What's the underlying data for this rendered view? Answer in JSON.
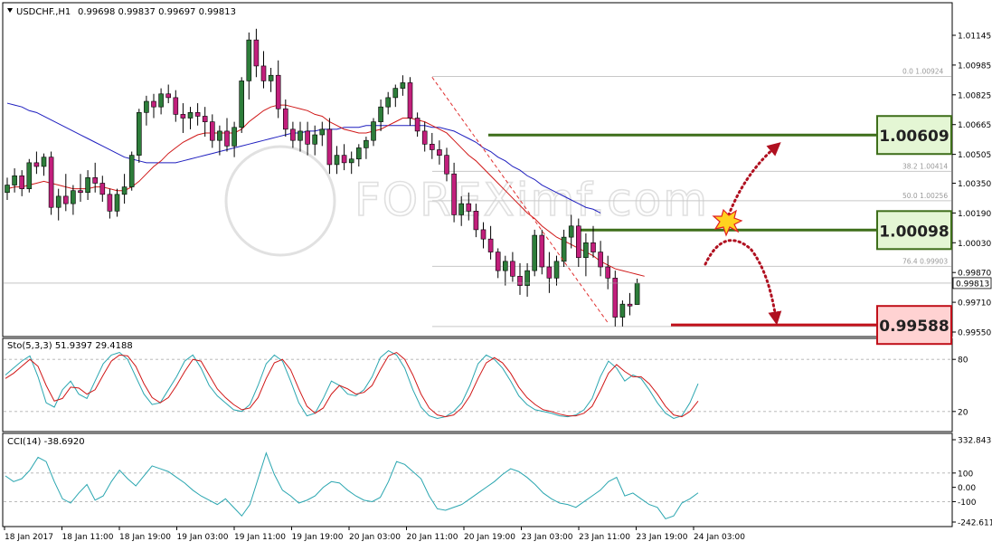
{
  "header": {
    "symbol": "USDCHF.,H1",
    "ohlc": "0.99698 0.99837 0.99697 0.99813"
  },
  "watermark": "FOREXimf.com",
  "chart_data": [
    {
      "type": "candlestick",
      "symbol": "USDCHF.,H1",
      "ylim": [
        0.9955,
        1.01145
      ],
      "price_ticks": [
        "1.01145",
        "1.00985",
        "1.00825",
        "1.00665",
        "1.00505",
        "1.00350",
        "1.00190",
        "1.00030",
        "0.99870",
        "0.99710",
        "0.99550"
      ],
      "current_price": "0.99813",
      "time_labels": [
        "18 Jan 2017",
        "18 Jan 11:00",
        "18 Jan 19:00",
        "19 Jan 03:00",
        "19 Jan 11:00",
        "19 Jan 19:00",
        "20 Jan 03:00",
        "20 Jan 11:00",
        "20 Jan 19:00",
        "23 Jan 03:00",
        "23 Jan 11:00",
        "23 Jan 19:00",
        "24 Jan 03:00"
      ],
      "fib_levels": [
        {
          "label": "0.0  1.00924",
          "value": 1.00924
        },
        {
          "label": "38.2  1.00414",
          "value": 1.00414
        },
        {
          "label": "50.0  1.00256",
          "value": 1.00256
        },
        {
          "label": "76.4  0.99903",
          "value": 0.99903
        }
      ],
      "key_levels": [
        {
          "label": "1.00609",
          "value": 1.00609,
          "color": "#3e6e1a",
          "fill": "#e4f6d4"
        },
        {
          "label": "1.00098",
          "value": 1.00098,
          "color": "#3e6e1a",
          "fill": "#e4f6d4"
        },
        {
          "label": "0.99588",
          "value": 0.99588,
          "color": "#c0101a",
          "fill": "#ffd2d2"
        }
      ],
      "bull_color": "#2d7d3a",
      "bear_color": "#c21f7c",
      "candles": [
        [
          1.003,
          1.0038,
          1.0026,
          1.0034
        ],
        [
          1.0034,
          1.0043,
          1.003,
          1.0039
        ],
        [
          1.0039,
          1.0042,
          1.0028,
          1.0032
        ],
        [
          1.0032,
          1.0048,
          1.003,
          1.0046
        ],
        [
          1.0046,
          1.0052,
          1.004,
          1.0044
        ],
        [
          1.0044,
          1.0051,
          1.0039,
          1.0049
        ],
        [
          1.0049,
          1.0052,
          1.0018,
          1.0022
        ],
        [
          1.0022,
          1.0032,
          1.0015,
          1.0028
        ],
        [
          1.0028,
          1.004,
          1.002,
          1.0024
        ],
        [
          1.0024,
          1.0034,
          1.0018,
          1.0031
        ],
        [
          1.0031,
          1.004,
          1.0025,
          1.003
        ],
        [
          1.003,
          1.0042,
          1.0026,
          1.0038
        ],
        [
          1.0038,
          1.0046,
          1.003,
          1.0035
        ],
        [
          1.0035,
          1.0039,
          1.0025,
          1.0029
        ],
        [
          1.0029,
          1.0032,
          1.0016,
          1.002
        ],
        [
          1.002,
          1.0032,
          1.0017,
          1.0029
        ],
        [
          1.0029,
          1.004,
          1.0024,
          1.0033
        ],
        [
          1.0033,
          1.0052,
          1.0031,
          1.005
        ],
        [
          1.005,
          1.0075,
          1.0046,
          1.0073
        ],
        [
          1.0073,
          1.0082,
          1.0066,
          1.0079
        ],
        [
          1.0079,
          1.0083,
          1.007,
          1.0076
        ],
        [
          1.0076,
          1.0086,
          1.0072,
          1.0083
        ],
        [
          1.0083,
          1.0088,
          1.0078,
          1.0081
        ],
        [
          1.0081,
          1.0085,
          1.0068,
          1.0072
        ],
        [
          1.0072,
          1.0078,
          1.0062,
          1.007
        ],
        [
          1.007,
          1.0076,
          1.0064,
          1.0073
        ],
        [
          1.0073,
          1.0078,
          1.0066,
          1.0071
        ],
        [
          1.0071,
          1.0076,
          1.006,
          1.0068
        ],
        [
          1.0068,
          1.0072,
          1.0054,
          1.0058
        ],
        [
          1.0058,
          1.0066,
          1.005,
          1.0063
        ],
        [
          1.0063,
          1.007,
          1.0052,
          1.0055
        ],
        [
          1.0055,
          1.0068,
          1.0049,
          1.0065
        ],
        [
          1.0065,
          1.0092,
          1.0062,
          1.009
        ],
        [
          1.009,
          1.0116,
          1.008,
          1.0112
        ],
        [
          1.0112,
          1.0118,
          1.0092,
          1.0098
        ],
        [
          1.0098,
          1.0106,
          1.0086,
          1.009
        ],
        [
          1.009,
          1.0097,
          1.0084,
          1.0093
        ],
        [
          1.0093,
          1.0101,
          1.007,
          1.0075
        ],
        [
          1.0075,
          1.008,
          1.006,
          1.0064
        ],
        [
          1.0064,
          1.0068,
          1.0054,
          1.0058
        ],
        [
          1.0058,
          1.0068,
          1.0052,
          1.0063
        ],
        [
          1.0063,
          1.0068,
          1.005,
          1.0056
        ],
        [
          1.0056,
          1.0066,
          1.005,
          1.0061
        ],
        [
          1.0061,
          1.0068,
          1.0055,
          1.0064
        ],
        [
          1.0064,
          1.007,
          1.004,
          1.0045
        ],
        [
          1.0045,
          1.0055,
          1.004,
          1.005
        ],
        [
          1.005,
          1.0056,
          1.0042,
          1.0046
        ],
        [
          1.0046,
          1.0052,
          1.004,
          1.0048
        ],
        [
          1.0048,
          1.0056,
          1.0044,
          1.0054
        ],
        [
          1.0054,
          1.006,
          1.0048,
          1.0058
        ],
        [
          1.0058,
          1.007,
          1.0055,
          1.0068
        ],
        [
          1.0068,
          1.008,
          1.0063,
          1.0076
        ],
        [
          1.0076,
          1.0084,
          1.0072,
          1.0081
        ],
        [
          1.0081,
          1.0088,
          1.0076,
          1.0086
        ],
        [
          1.0086,
          1.0093,
          1.0082,
          1.0089
        ],
        [
          1.0089,
          1.0092,
          1.0066,
          1.007
        ],
        [
          1.007,
          1.0073,
          1.006,
          1.0063
        ],
        [
          1.0063,
          1.0068,
          1.0052,
          1.0056
        ],
        [
          1.0056,
          1.0062,
          1.0048,
          1.0053
        ],
        [
          1.0053,
          1.0058,
          1.0045,
          1.005
        ],
        [
          1.005,
          1.0054,
          1.0036,
          1.004
        ],
        [
          1.004,
          1.0046,
          1.0014,
          1.0018
        ],
        [
          1.0018,
          1.0028,
          1.0012,
          1.0024
        ],
        [
          1.0024,
          1.003,
          1.0015,
          1.002
        ],
        [
          1.002,
          1.0024,
          1.0006,
          1.001
        ],
        [
          1.001,
          1.0014,
          1.0,
          1.0005
        ],
        [
          1.0005,
          1.0012,
          0.9994,
          0.9998
        ],
        [
          0.9998,
          1.0,
          0.9984,
          0.9988
        ],
        [
          0.9988,
          0.9996,
          0.998,
          0.9993
        ],
        [
          0.9993,
          0.9998,
          0.9982,
          0.9985
        ],
        [
          0.9985,
          0.9992,
          0.9975,
          0.998
        ],
        [
          0.998,
          0.9992,
          0.9974,
          0.9988
        ],
        [
          0.9988,
          1.001,
          0.9985,
          1.0007
        ],
        [
          1.0007,
          1.001,
          0.9986,
          0.999
        ],
        [
          0.999,
          0.9998,
          0.9976,
          0.9984
        ],
        [
          0.9984,
          0.9996,
          0.998,
          0.9993
        ],
        [
          0.9993,
          1.001,
          0.999,
          1.0006
        ],
        [
          1.0006,
          1.0018,
          1.0,
          1.0012
        ],
        [
          1.0012,
          1.0016,
          0.999,
          0.9995
        ],
        [
          0.9995,
          1.0008,
          0.9985,
          1.0003
        ],
        [
          1.0003,
          1.0012,
          0.9995,
          0.9998
        ],
        [
          0.9998,
          1.0004,
          0.9985,
          0.999
        ],
        [
          0.999,
          0.9996,
          0.9978,
          0.9984
        ],
        [
          0.9984,
          0.9988,
          0.9958,
          0.9963
        ],
        [
          0.9963,
          0.9972,
          0.9958,
          0.997
        ],
        [
          0.997,
          0.9976,
          0.9964,
          0.9969
        ],
        [
          0.99698,
          0.99837,
          0.99697,
          0.99813
        ]
      ],
      "ma_red": [
        1.0032,
        1.0033,
        1.0033,
        1.0034,
        1.0035,
        1.0036,
        1.0035,
        1.0034,
        1.0033,
        1.0032,
        1.0032,
        1.0032,
        1.0033,
        1.0033,
        1.0032,
        1.0031,
        1.0031,
        1.0033,
        1.0036,
        1.004,
        1.0044,
        1.0047,
        1.0051,
        1.0054,
        1.0057,
        1.0059,
        1.0061,
        1.0062,
        1.0062,
        1.0062,
        1.0062,
        1.0062,
        1.0064,
        1.0068,
        1.0071,
        1.0074,
        1.0076,
        1.0077,
        1.0077,
        1.0076,
        1.0075,
        1.0074,
        1.0072,
        1.0071,
        1.0068,
        1.0066,
        1.0064,
        1.0063,
        1.0062,
        1.0062,
        1.0063,
        1.0064,
        1.0066,
        1.0068,
        1.007,
        1.007,
        1.0069,
        1.0068,
        1.0066,
        1.0064,
        1.0062,
        1.0058,
        1.0054,
        1.005,
        1.0047,
        1.0043,
        1.0039,
        1.0035,
        1.0031,
        1.0027,
        1.0023,
        1.0019,
        1.0016,
        1.0012,
        1.0009,
        1.0006,
        1.0004,
        1.0002,
        1.0,
        0.9998,
        0.9996,
        0.9993,
        0.9991,
        0.9989,
        0.9988,
        0.9987,
        0.9986,
        0.9985
      ],
      "ma_blue": [
        1.0078,
        1.0077,
        1.0076,
        1.0074,
        1.0073,
        1.0071,
        1.0069,
        1.0067,
        1.0065,
        1.0063,
        1.0061,
        1.0059,
        1.0057,
        1.0055,
        1.0053,
        1.0051,
        1.0049,
        1.0048,
        1.0047,
        1.0046,
        1.0046,
        1.0046,
        1.0046,
        1.0046,
        1.0047,
        1.0048,
        1.0049,
        1.005,
        1.0051,
        1.0052,
        1.0053,
        1.0054,
        1.0055,
        1.0056,
        1.0057,
        1.0058,
        1.0059,
        1.006,
        1.0061,
        1.0062,
        1.0062,
        1.0063,
        1.0063,
        1.0064,
        1.0064,
        1.0064,
        1.0065,
        1.0065,
        1.0065,
        1.0066,
        1.0066,
        1.0066,
        1.0066,
        1.0066,
        1.0066,
        1.0066,
        1.0066,
        1.0066,
        1.0065,
        1.0065,
        1.0064,
        1.0063,
        1.0061,
        1.0059,
        1.0057,
        1.0054,
        1.0052,
        1.0049,
        1.0047,
        1.0044,
        1.0042,
        1.0039,
        1.0037,
        1.0034,
        1.0032,
        1.003,
        1.0028,
        1.0026,
        1.0024,
        1.0022,
        1.0021,
        1.0019
      ]
    },
    {
      "type": "line",
      "title": "Sto(5,3,3) 51.9397 29.4188",
      "ylim": [
        0,
        100
      ],
      "ticks": [
        "80",
        "20"
      ],
      "series": [
        {
          "name": "main",
          "color": "#2aa6b0",
          "values": [
            62,
            70,
            78,
            84,
            60,
            30,
            25,
            45,
            55,
            40,
            35,
            55,
            75,
            85,
            88,
            80,
            60,
            40,
            28,
            30,
            45,
            60,
            78,
            85,
            70,
            50,
            38,
            30,
            22,
            20,
            28,
            50,
            75,
            85,
            78,
            55,
            30,
            15,
            18,
            35,
            55,
            50,
            40,
            38,
            45,
            60,
            82,
            90,
            85,
            70,
            45,
            25,
            15,
            12,
            14,
            20,
            30,
            50,
            75,
            85,
            80,
            70,
            55,
            38,
            28,
            22,
            20,
            18,
            15,
            14,
            16,
            22,
            35,
            60,
            78,
            70,
            55,
            62,
            58,
            45,
            30,
            18,
            12,
            15,
            30,
            52
          ]
        },
        {
          "name": "signal",
          "color": "#d01818",
          "values": [
            58,
            64,
            72,
            80,
            72,
            50,
            32,
            35,
            48,
            47,
            40,
            45,
            62,
            78,
            85,
            84,
            72,
            52,
            36,
            30,
            36,
            50,
            66,
            80,
            78,
            62,
            46,
            36,
            28,
            22,
            24,
            36,
            58,
            76,
            80,
            68,
            46,
            26,
            18,
            24,
            40,
            50,
            46,
            40,
            42,
            50,
            68,
            84,
            88,
            80,
            62,
            40,
            24,
            16,
            14,
            16,
            24,
            38,
            58,
            76,
            82,
            76,
            64,
            48,
            36,
            28,
            22,
            20,
            17,
            15,
            15,
            18,
            26,
            44,
            64,
            74,
            66,
            60,
            60,
            52,
            40,
            26,
            16,
            14,
            20,
            32
          ]
        }
      ]
    },
    {
      "type": "line",
      "title": "CCI(14) -38.6920",
      "ylim": [
        -242.6118,
        332.843
      ],
      "ticks": [
        "332.843",
        "100",
        "0.00",
        "-100",
        "-242.6118"
      ],
      "series": [
        {
          "name": "cci",
          "color": "#2aa6b0",
          "values": [
            80,
            40,
            60,
            120,
            210,
            180,
            40,
            -80,
            -110,
            -40,
            20,
            -90,
            -60,
            40,
            120,
            60,
            10,
            80,
            150,
            130,
            110,
            70,
            30,
            -20,
            -60,
            -90,
            -120,
            -80,
            -140,
            -200,
            -120,
            60,
            240,
            90,
            -20,
            -60,
            -110,
            -90,
            -60,
            0,
            40,
            30,
            -20,
            -60,
            -90,
            -100,
            -70,
            40,
            180,
            160,
            110,
            60,
            -60,
            -150,
            -160,
            -140,
            -120,
            -80,
            -40,
            0,
            40,
            90,
            130,
            110,
            70,
            20,
            -40,
            -80,
            -110,
            -120,
            -140,
            -100,
            -60,
            -20,
            40,
            70,
            -60,
            -40,
            -80,
            -120,
            -140,
            -220,
            -200,
            -110,
            -80,
            -38.692
          ]
        }
      ]
    }
  ]
}
